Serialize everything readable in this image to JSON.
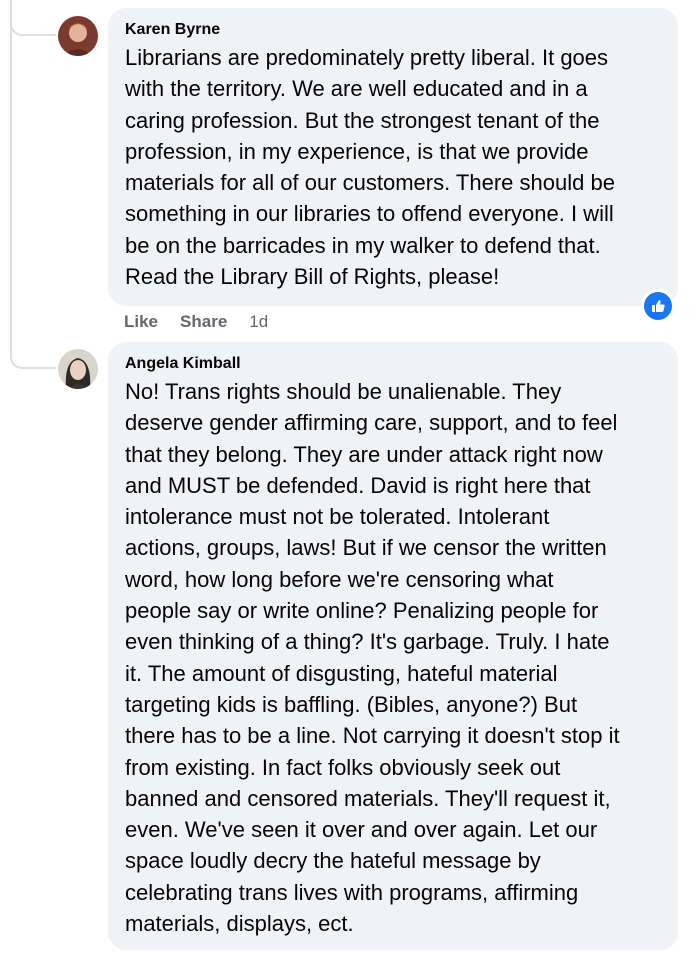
{
  "comments": [
    {
      "author": "Karen Byrne",
      "text": "Librarians are predominately pretty liberal. It goes\nwith the territory. We are well educated and in a\ncaring profession. But the strongest tenant of the\nprofession, in my experience, is that we provide\nmaterials for all of our customers. There should be\nsomething in our libraries to offend everyone. I will\nbe on the barricades in my walker to defend that.\nRead the Library Bill of Rights, please!",
      "actions": {
        "like": "Like",
        "share": "Share",
        "time": "1d"
      },
      "reaction_icon": "like-thumb-icon"
    },
    {
      "author": "Angela Kimball",
      "text": "No! Trans rights should be unalienable. They\ndeserve gender affirming care, support, and to feel\nthat they belong. They are under attack right now\nand MUST be defended. David is right here that\nintolerance must not be tolerated. Intolerant\nactions, groups, laws! But if we censor the written\nword, how long before we're censoring what\npeople say or write online? Penalizing people for\neven thinking of a thing? It's garbage. Truly. I hate\nit. The amount of disgusting, hateful material\ntargeting kids is baffling. (Bibles, anyone?) But\nthere has to be a line. Not carrying it doesn't stop it\nfrom existing. In fact folks obviously seek out\nbanned and censored materials. They'll request it,\neven. We've seen it over and over again. Let our\nspace loudly decry the hateful message by\ncelebrating trans lives with programs, affirming\nmaterials, displays, ect."
    }
  ],
  "colors": {
    "bubble": "#f0f2f5",
    "action_text": "#65676b",
    "like_blue": "#1877f2"
  }
}
